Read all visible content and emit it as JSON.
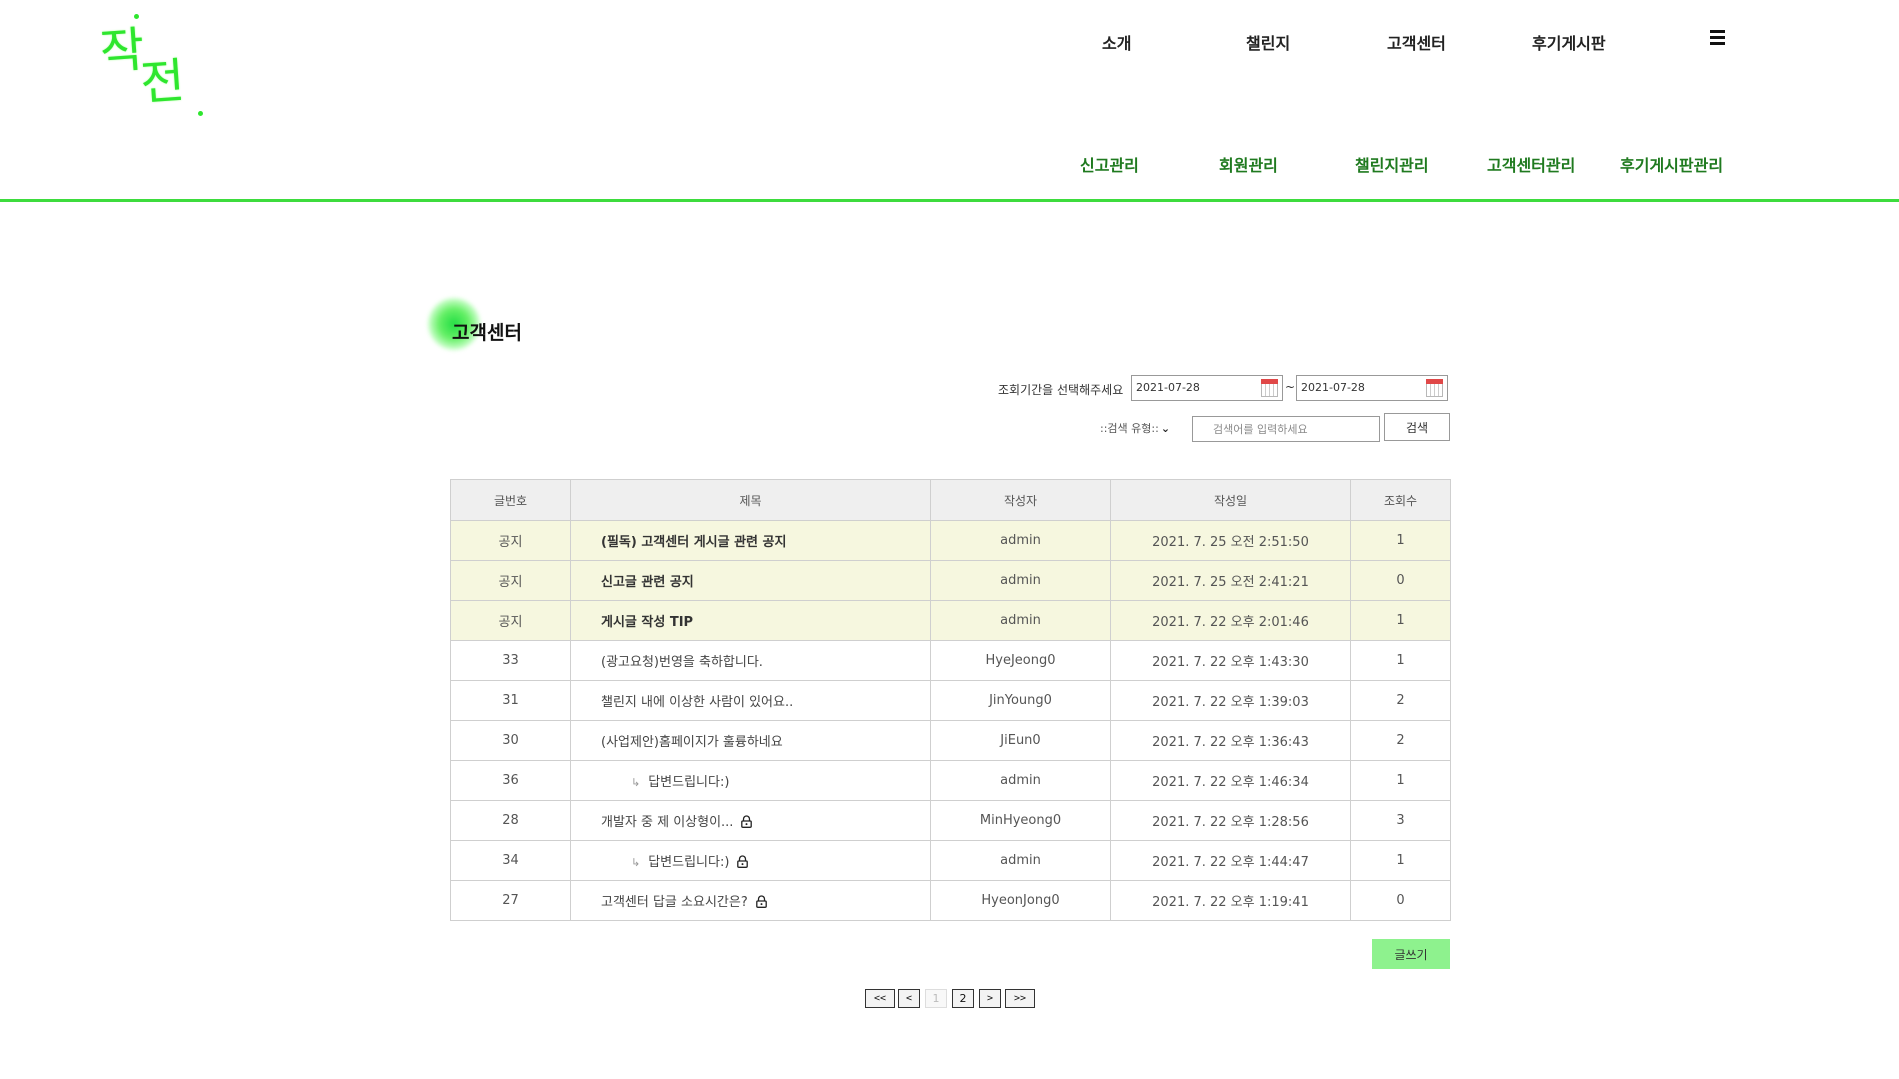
{
  "logo": {
    "text_top": "작",
    "text_bottom": "전"
  },
  "top_nav": {
    "items": [
      "소개",
      "챌린지",
      "고객센터",
      "후기게시판"
    ]
  },
  "admin_nav": {
    "items": [
      "신고관리",
      "회원관리",
      "챌린지관리",
      "고객센터관리",
      "후기게시판관리"
    ]
  },
  "colors": {
    "accent": "#3ddc3d",
    "notice_row": "#f6f7df",
    "write_button": "#8ef28e"
  },
  "page_title": "고객센터",
  "filters": {
    "period_label": "조회기간을 선택해주세요",
    "date_from": "2021-07-28",
    "tilde": "~",
    "date_to": "2021-07-28",
    "search_type": "::검색 유형::",
    "search_placeholder": "검색어를 입력하세요",
    "search_button": "검색"
  },
  "table": {
    "headers": [
      "글번호",
      "제목",
      "작성자",
      "작성일",
      "조회수"
    ],
    "rows": [
      {
        "no": "공지",
        "title": "(필독) 고객센터 게시글 관련 공지",
        "author": "admin",
        "date": "2021. 7. 25 오전 2:51:50",
        "views": "1"
      },
      {
        "no": "공지",
        "title": "신고글 관련 공지",
        "author": "admin",
        "date": "2021. 7. 25 오전 2:41:21",
        "views": "0"
      },
      {
        "no": "공지",
        "title": "게시글 작성 TIP",
        "author": "admin",
        "date": "2021. 7. 22 오후 2:01:46",
        "views": "1"
      },
      {
        "no": "33",
        "title": "(광고요청)번영을 축하합니다.",
        "author": "HyeJeong0",
        "date": "2021. 7. 22 오후 1:43:30",
        "views": "1"
      },
      {
        "no": "31",
        "title": "챌린지 내에 이상한 사람이 있어요..",
        "author": "JinYoung0",
        "date": "2021. 7. 22 오후 1:39:03",
        "views": "2"
      },
      {
        "no": "30",
        "title": "(사업제안)홈페이지가 훌륭하네요",
        "author": "JiEun0",
        "date": "2021. 7. 22 오후 1:36:43",
        "views": "2"
      },
      {
        "no": "36",
        "title": "답변드립니다:)",
        "author": "admin",
        "date": "2021. 7. 22 오후 1:46:34",
        "views": "1"
      },
      {
        "no": "28",
        "title": "개발자 중 제 이상형이...",
        "author": "MinHyeong0",
        "date": "2021. 7. 22 오후 1:28:56",
        "views": "3"
      },
      {
        "no": "34",
        "title": "답변드립니다:)",
        "author": "admin",
        "date": "2021. 7. 22 오후 1:44:47",
        "views": "1"
      },
      {
        "no": "27",
        "title": "고객센터 답글 소요시간은?",
        "author": "HyeonJong0",
        "date": "2021. 7. 22 오후 1:19:41",
        "views": "0"
      }
    ]
  },
  "write_button": "글쓰기",
  "pagination": {
    "first": "<<",
    "prev": "<",
    "pages": [
      "1",
      "2"
    ],
    "next": ">",
    "last": ">>"
  }
}
